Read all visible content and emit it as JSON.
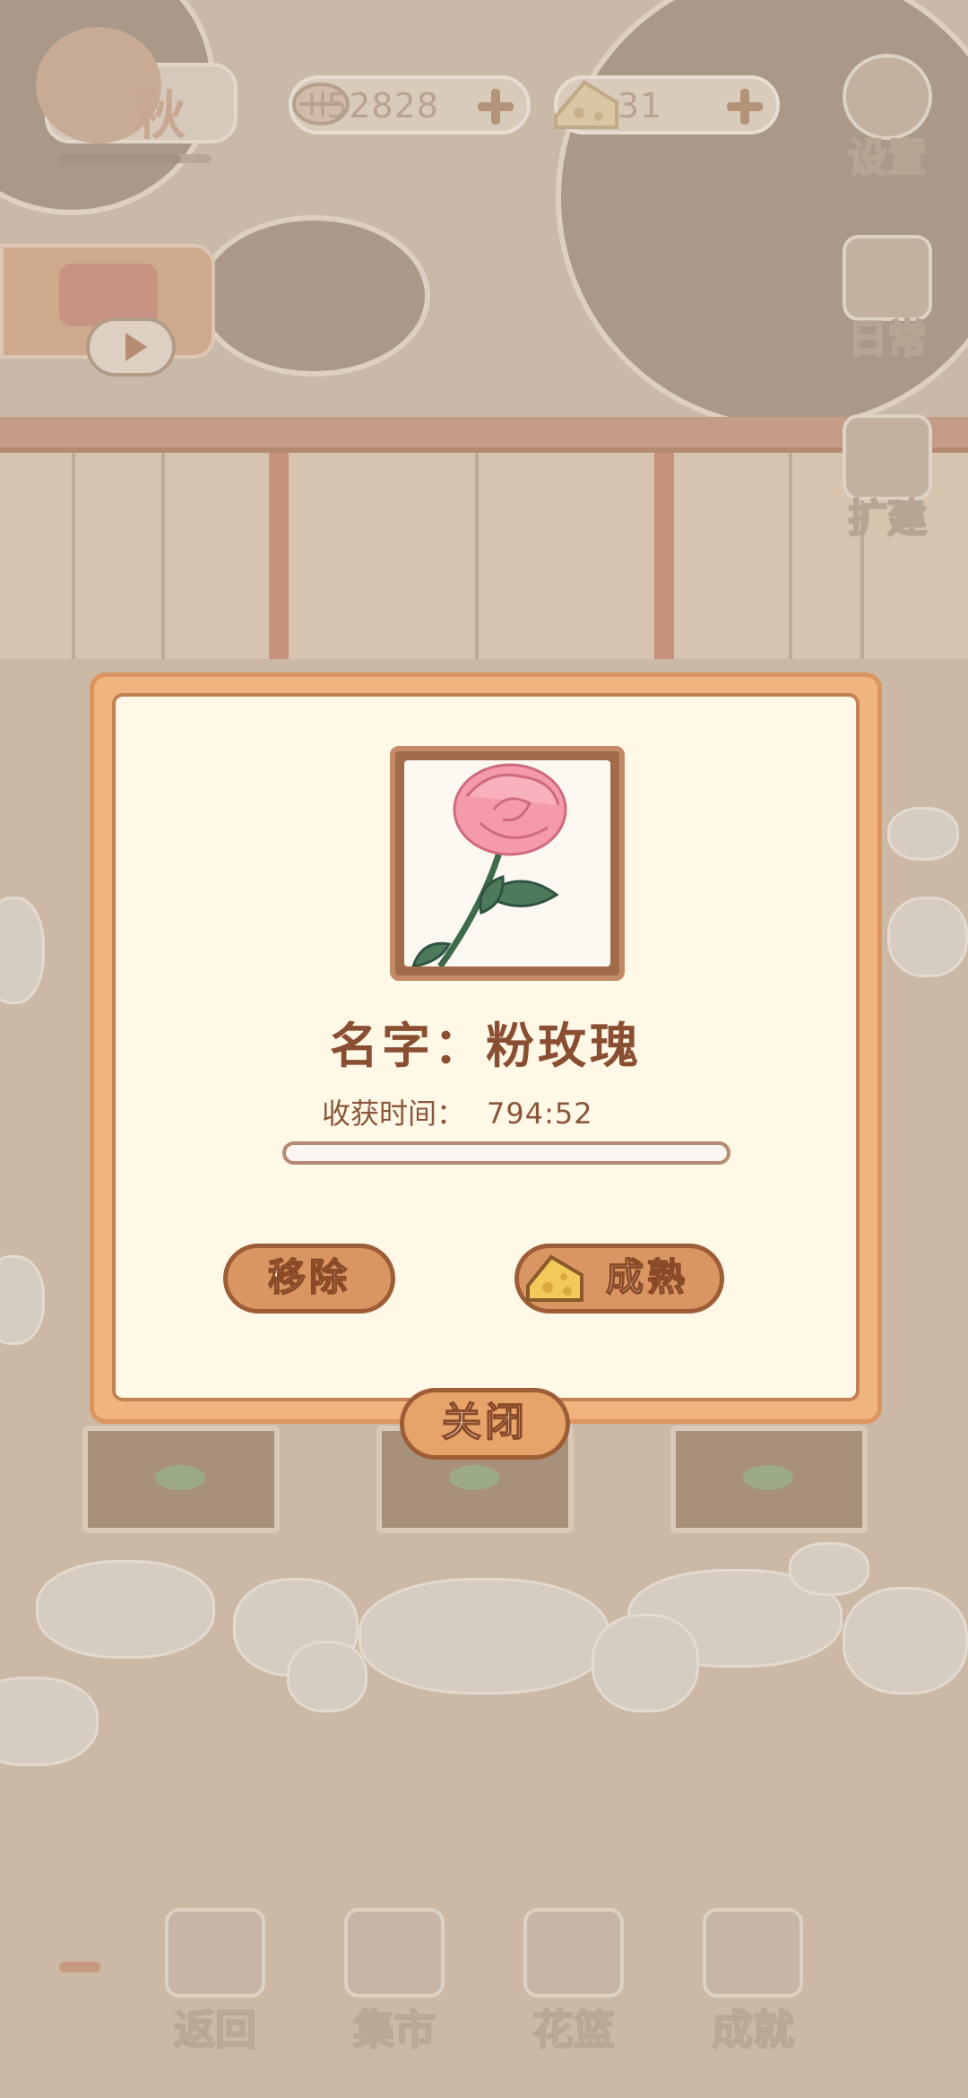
{
  "hud": {
    "season_label": "秋",
    "season_progress": 0.8,
    "fish_amount": "52828",
    "cheese_amount": "31",
    "settings_label": "设置",
    "daily_label": "日常",
    "expand_label": "扩建"
  },
  "dialog": {
    "flower_name": "名字：粉玫瑰",
    "harvest_label": "收获时间：",
    "harvest_time": "794:52",
    "harvest_progress": 0.0,
    "remove_label": "移除",
    "ripen_label": "成熟",
    "close_label": "关闭"
  },
  "bottom_nav": {
    "items": [
      {
        "label": "返回",
        "icon": "window-icon"
      },
      {
        "label": "集市",
        "icon": "market-stall-icon"
      },
      {
        "label": "花篮",
        "icon": "flower-basket-icon"
      },
      {
        "label": "成就",
        "icon": "trophy-icon"
      }
    ]
  },
  "colors": {
    "dialog_border": "#f0b47f",
    "dialog_inner": "#fff8e7",
    "button_fill": "#d99662",
    "title_text": "#8a4f32"
  }
}
